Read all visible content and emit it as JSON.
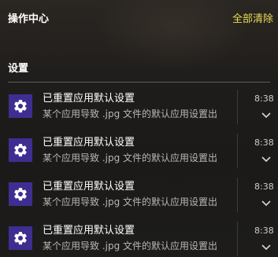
{
  "header": {
    "title": "操作中心",
    "clear_all_label": "全部清除"
  },
  "group": {
    "title": "设置"
  },
  "notifications": [
    {
      "icon": "gear-icon",
      "title": "已重置应用默认设置",
      "body": "某个应用导致 .jpg 文件的默认应用设置出",
      "time": "8:38"
    },
    {
      "icon": "gear-icon",
      "title": "已重置应用默认设置",
      "body": "某个应用导致 .jpg 文件的默认应用设置出",
      "time": "8:38"
    },
    {
      "icon": "gear-icon",
      "title": "已重置应用默认设置",
      "body": "某个应用导致 .jpg 文件的默认应用设置出",
      "time": "8:38"
    },
    {
      "icon": "gear-icon",
      "title": "已重置应用默认设置",
      "body": "某个应用导致 .jpg 文件的默认应用设置出",
      "time": "8:38"
    }
  ],
  "colors": {
    "accent_link": "#e8dc54",
    "app_icon_bg": "#3f2e91",
    "panel_bg": "#1f1d1b"
  }
}
